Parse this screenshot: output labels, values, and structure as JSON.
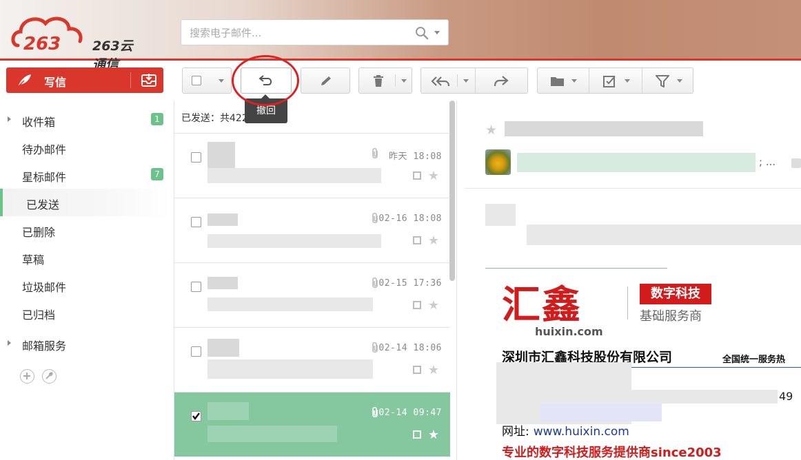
{
  "brand": {
    "logo_text": "263云通信"
  },
  "search": {
    "placeholder": "搜索电子邮件..."
  },
  "compose": {
    "label": "写信"
  },
  "sidebar": {
    "items": [
      {
        "label": "收件箱",
        "badge": "1",
        "expandable": true
      },
      {
        "label": "待办邮件"
      },
      {
        "label": "星标邮件",
        "badge": "7"
      },
      {
        "label": "已发送",
        "active": true
      },
      {
        "label": "已删除"
      },
      {
        "label": "草稿"
      },
      {
        "label": "垃圾邮件"
      },
      {
        "label": "已归档"
      },
      {
        "label": "邮箱服务",
        "expandable": true
      }
    ]
  },
  "toolbar": {
    "tooltip": "撤回"
  },
  "mail_list": {
    "header": "已发送：共422封",
    "rows": [
      {
        "date": "昨天 18:08",
        "checked": false
      },
      {
        "date": "02-16 18:08",
        "checked": false
      },
      {
        "date": "02-15 17:36",
        "checked": false
      },
      {
        "date": "02-14 18:06",
        "checked": false
      },
      {
        "date": "02-14 09:47",
        "checked": true
      }
    ]
  },
  "reading_pane": {
    "recipients_suffix": "; ...",
    "signature": {
      "brand_cn": "汇鑫",
      "brand_url": "huixin.com",
      "tag": "数字科技",
      "subtitle": "基础服务商",
      "company": "深圳市汇鑫科技股份有限公司",
      "hotline_label": "全国统一服务热",
      "phone_tail": "49",
      "website_label": "网址:",
      "website": "www.huixin.com",
      "slogan": "专业的数字科技服务提供商since2003"
    }
  },
  "colors": {
    "accent": "#d9372b",
    "green": "#6cc28b",
    "selected_row": "#85c89f"
  }
}
